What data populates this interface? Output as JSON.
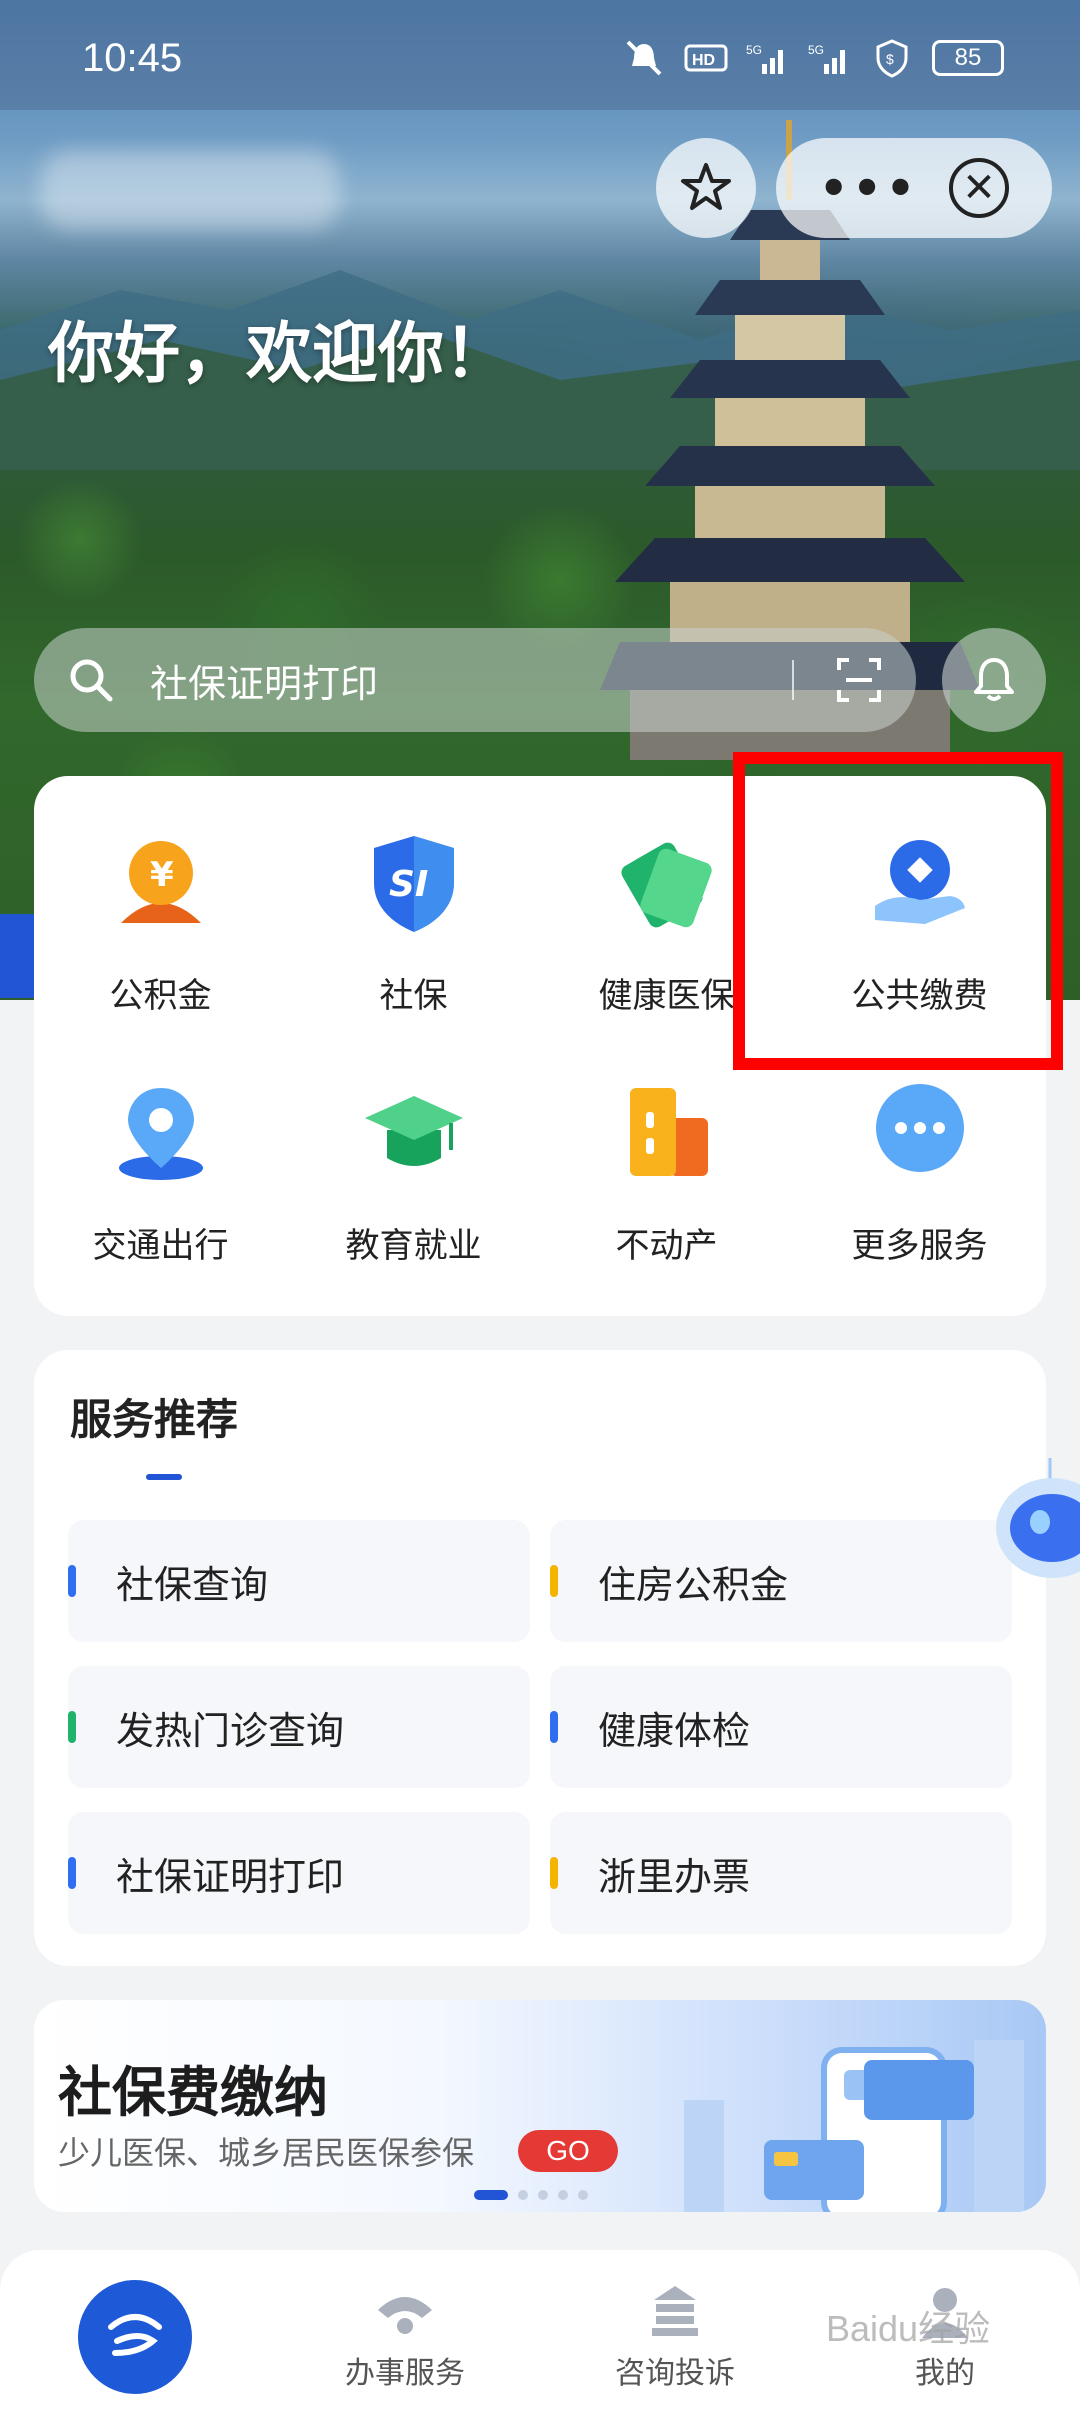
{
  "status_bar": {
    "time": "10:45",
    "battery": "85"
  },
  "header": {
    "greeting": "你好，欢迎你！"
  },
  "search": {
    "placeholder": "社保证明打印"
  },
  "services": [
    {
      "label": "公积金",
      "icon": "housing-fund-icon"
    },
    {
      "label": "社保",
      "icon": "social-security-icon"
    },
    {
      "label": "健康医保",
      "icon": "health-insurance-icon"
    },
    {
      "label": "公共缴费",
      "icon": "public-payment-icon"
    },
    {
      "label": "交通出行",
      "icon": "transport-icon"
    },
    {
      "label": "教育就业",
      "icon": "education-icon"
    },
    {
      "label": "不动产",
      "icon": "real-estate-icon"
    },
    {
      "label": "更多服务",
      "icon": "more-services-icon"
    }
  ],
  "recommend": {
    "title": "服务推荐",
    "items": [
      {
        "label": "社保查询",
        "color": "#2f6ef0"
      },
      {
        "label": "住房公积金",
        "color": "#f5b400"
      },
      {
        "label": "发热门诊查询",
        "color": "#1fb36c"
      },
      {
        "label": "健康体检",
        "color": "#2f6ef0"
      },
      {
        "label": "社保证明打印",
        "color": "#2f6ef0"
      },
      {
        "label": "浙里办票",
        "color": "#f5b400"
      }
    ]
  },
  "banner": {
    "title": "社保费缴纳",
    "subtitle": "少儿医保、城乡居民医保参保",
    "badge": "GO"
  },
  "bottom_nav": [
    {
      "label": "",
      "icon": "home-icon"
    },
    {
      "label": "办事服务",
      "icon": "service-icon"
    },
    {
      "label": "咨询投诉",
      "icon": "consult-icon"
    },
    {
      "label": "我的",
      "icon": "profile-icon"
    }
  ],
  "watermark": "Baidu经验",
  "colors": {
    "accent": "#2155d6",
    "highlight": "#ff0000"
  }
}
